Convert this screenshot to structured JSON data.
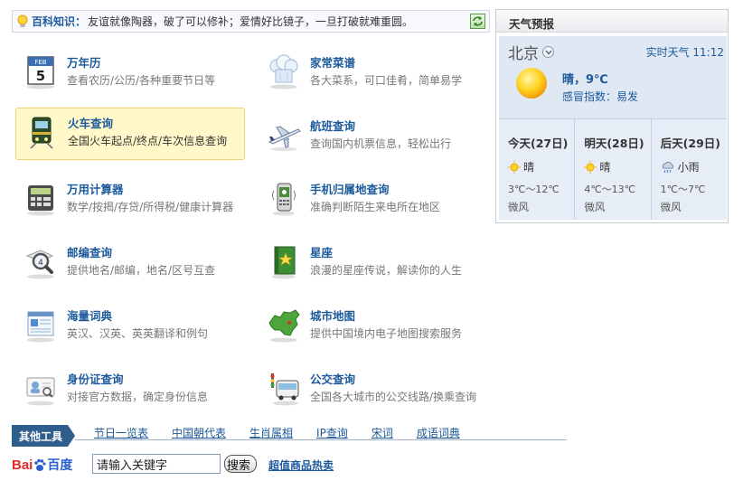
{
  "tip": {
    "title": "百科知识：",
    "text": "友谊就像陶器，破了可以修补；爱情好比镜子，一旦打破就难重圆。"
  },
  "services": [
    {
      "name": "万年历",
      "desc": "查看农历/公历/各种重要节日等",
      "icon": "calendar-icon",
      "calendar_label": "FEB",
      "calendar_day": "5"
    },
    {
      "name": "家常菜谱",
      "desc": "各大菜系，可口佳肴，简单易学",
      "icon": "chef-hat-icon"
    },
    {
      "name": "火车查询",
      "desc": "全国火车起点/终点/车次信息查询",
      "icon": "train-icon",
      "active": true
    },
    {
      "name": "航班查询",
      "desc": "查询国内机票信息，轻松出行",
      "icon": "airplane-icon"
    },
    {
      "name": "万用计算器",
      "desc": "数学/按揭/存贷/所得税/健康计算器",
      "icon": "calculator-icon"
    },
    {
      "name": "手机归属地查询",
      "desc": "准确判断陌生来电所在地区",
      "icon": "mobile-phone-icon"
    },
    {
      "name": "邮编查询",
      "desc": "提供地名/邮编，地名/区号互查",
      "icon": "magnifier-icon"
    },
    {
      "name": "星座",
      "desc": "浪漫的星座传说，解读你的人生",
      "icon": "star-book-icon"
    },
    {
      "name": "海量词典",
      "desc": "英汉、汉英、英英翻译和例句",
      "icon": "dictionary-icon"
    },
    {
      "name": "城市地图",
      "desc": "提供中国境内电子地图搜索服务",
      "icon": "china-map-icon"
    },
    {
      "name": "身份证查询",
      "desc": "对接官方数据，确定身份信息",
      "icon": "id-card-icon"
    },
    {
      "name": "公交查询",
      "desc": "全国各大城市的公交线路/换乘查询",
      "icon": "bus-icon"
    }
  ],
  "weather": {
    "header": "天气预报",
    "city": "北京",
    "live_label": "实时天气 11:12",
    "now": "晴，9℃",
    "index": "感冒指数：易发",
    "days": [
      {
        "title": "今天(27日)",
        "cond": "晴",
        "temp": "3℃～12℃",
        "wind": "微风",
        "icon": "sun-icon"
      },
      {
        "title": "明天(28日)",
        "cond": "晴",
        "temp": "4℃～13℃",
        "wind": "微风",
        "icon": "sun-icon"
      },
      {
        "title": "后天(29日)",
        "cond": "小雨",
        "temp": "1℃～7℃",
        "wind": "微风",
        "icon": "light-rain-icon"
      }
    ]
  },
  "tools": {
    "label": "其他工具",
    "links": [
      "节日一览表",
      "中国朝代表",
      "生肖属相",
      "IP查询",
      "宋词",
      "成语词典"
    ]
  },
  "baidu": {
    "logo_left": "Bai",
    "logo_right": "百度",
    "input_value": "请输入关键字",
    "button": "搜索",
    "hot_link": "超值商品热卖"
  },
  "colors": {
    "link_blue": "#1d5a9c",
    "active_bg": "#fff8c9",
    "tools_label_bg": "#2f5d8c",
    "weather_bg": "#dfe8f3"
  }
}
